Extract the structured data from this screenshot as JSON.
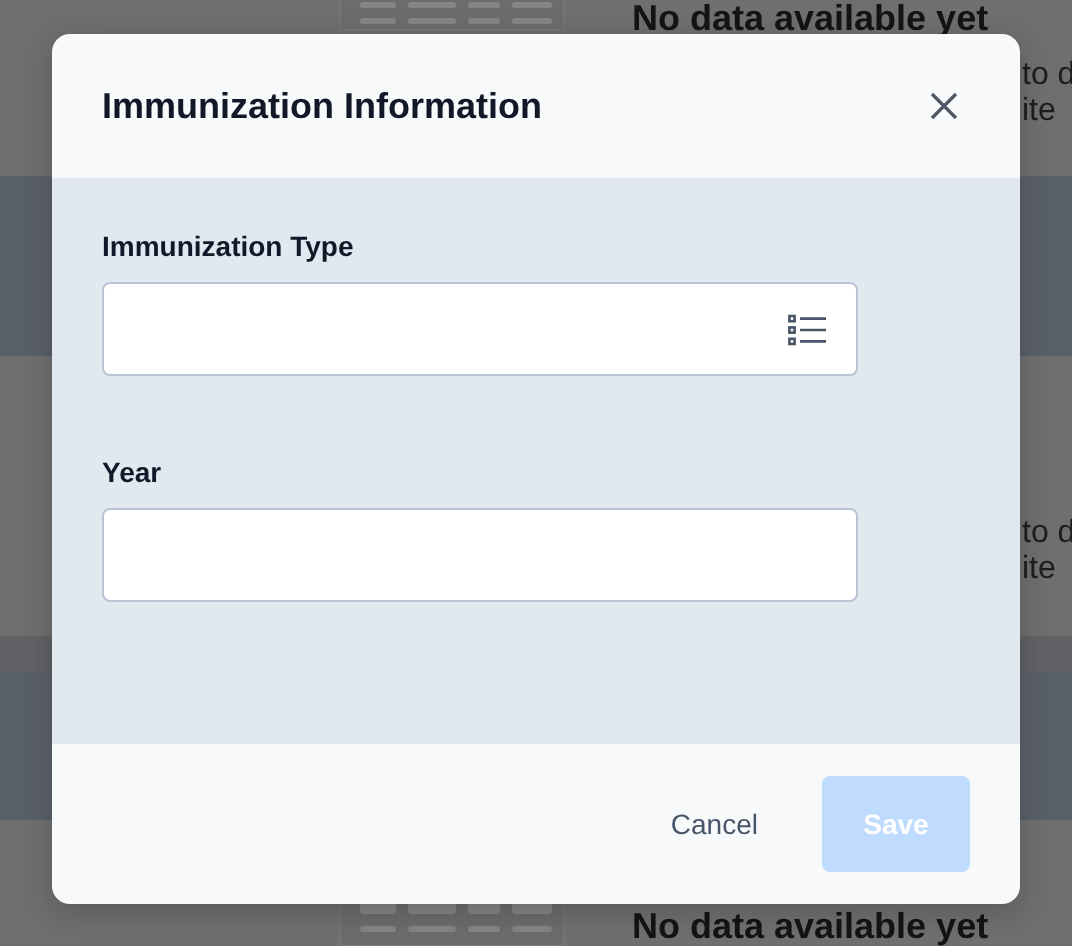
{
  "backdrop": {
    "top_heading": "No data available yet",
    "top_lines": [
      "to d",
      "ite"
    ],
    "middle_lines": [
      "to d",
      "ite"
    ],
    "bottom_heading": "No data available yet"
  },
  "dialog": {
    "title": "Immunization Information",
    "fields": [
      {
        "kind": "select",
        "label": "Immunization Type"
      },
      {
        "kind": "text",
        "label": "Year"
      }
    ],
    "buttons": [
      {
        "kind": "secondary",
        "label": "Cancel",
        "disabled": false
      },
      {
        "kind": "primary",
        "label": "Save",
        "disabled": true
      }
    ]
  }
}
